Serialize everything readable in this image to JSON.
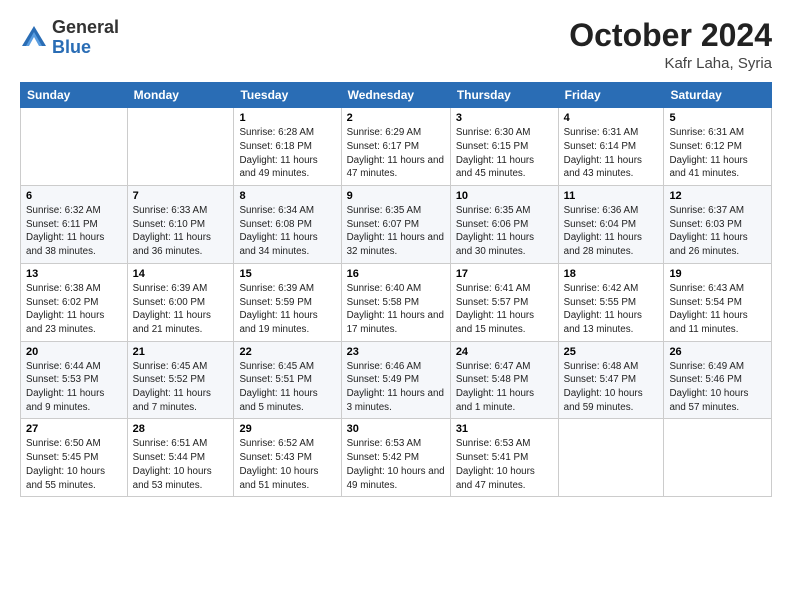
{
  "header": {
    "logo_general": "General",
    "logo_blue": "Blue",
    "month_title": "October 2024",
    "location": "Kafr Laha, Syria"
  },
  "days_of_week": [
    "Sunday",
    "Monday",
    "Tuesday",
    "Wednesday",
    "Thursday",
    "Friday",
    "Saturday"
  ],
  "weeks": [
    [
      {
        "day": "",
        "info": ""
      },
      {
        "day": "",
        "info": ""
      },
      {
        "day": "1",
        "info": "Sunrise: 6:28 AM\nSunset: 6:18 PM\nDaylight: 11 hours and 49 minutes."
      },
      {
        "day": "2",
        "info": "Sunrise: 6:29 AM\nSunset: 6:17 PM\nDaylight: 11 hours and 47 minutes."
      },
      {
        "day": "3",
        "info": "Sunrise: 6:30 AM\nSunset: 6:15 PM\nDaylight: 11 hours and 45 minutes."
      },
      {
        "day": "4",
        "info": "Sunrise: 6:31 AM\nSunset: 6:14 PM\nDaylight: 11 hours and 43 minutes."
      },
      {
        "day": "5",
        "info": "Sunrise: 6:31 AM\nSunset: 6:12 PM\nDaylight: 11 hours and 41 minutes."
      }
    ],
    [
      {
        "day": "6",
        "info": "Sunrise: 6:32 AM\nSunset: 6:11 PM\nDaylight: 11 hours and 38 minutes."
      },
      {
        "day": "7",
        "info": "Sunrise: 6:33 AM\nSunset: 6:10 PM\nDaylight: 11 hours and 36 minutes."
      },
      {
        "day": "8",
        "info": "Sunrise: 6:34 AM\nSunset: 6:08 PM\nDaylight: 11 hours and 34 minutes."
      },
      {
        "day": "9",
        "info": "Sunrise: 6:35 AM\nSunset: 6:07 PM\nDaylight: 11 hours and 32 minutes."
      },
      {
        "day": "10",
        "info": "Sunrise: 6:35 AM\nSunset: 6:06 PM\nDaylight: 11 hours and 30 minutes."
      },
      {
        "day": "11",
        "info": "Sunrise: 6:36 AM\nSunset: 6:04 PM\nDaylight: 11 hours and 28 minutes."
      },
      {
        "day": "12",
        "info": "Sunrise: 6:37 AM\nSunset: 6:03 PM\nDaylight: 11 hours and 26 minutes."
      }
    ],
    [
      {
        "day": "13",
        "info": "Sunrise: 6:38 AM\nSunset: 6:02 PM\nDaylight: 11 hours and 23 minutes."
      },
      {
        "day": "14",
        "info": "Sunrise: 6:39 AM\nSunset: 6:00 PM\nDaylight: 11 hours and 21 minutes."
      },
      {
        "day": "15",
        "info": "Sunrise: 6:39 AM\nSunset: 5:59 PM\nDaylight: 11 hours and 19 minutes."
      },
      {
        "day": "16",
        "info": "Sunrise: 6:40 AM\nSunset: 5:58 PM\nDaylight: 11 hours and 17 minutes."
      },
      {
        "day": "17",
        "info": "Sunrise: 6:41 AM\nSunset: 5:57 PM\nDaylight: 11 hours and 15 minutes."
      },
      {
        "day": "18",
        "info": "Sunrise: 6:42 AM\nSunset: 5:55 PM\nDaylight: 11 hours and 13 minutes."
      },
      {
        "day": "19",
        "info": "Sunrise: 6:43 AM\nSunset: 5:54 PM\nDaylight: 11 hours and 11 minutes."
      }
    ],
    [
      {
        "day": "20",
        "info": "Sunrise: 6:44 AM\nSunset: 5:53 PM\nDaylight: 11 hours and 9 minutes."
      },
      {
        "day": "21",
        "info": "Sunrise: 6:45 AM\nSunset: 5:52 PM\nDaylight: 11 hours and 7 minutes."
      },
      {
        "day": "22",
        "info": "Sunrise: 6:45 AM\nSunset: 5:51 PM\nDaylight: 11 hours and 5 minutes."
      },
      {
        "day": "23",
        "info": "Sunrise: 6:46 AM\nSunset: 5:49 PM\nDaylight: 11 hours and 3 minutes."
      },
      {
        "day": "24",
        "info": "Sunrise: 6:47 AM\nSunset: 5:48 PM\nDaylight: 11 hours and 1 minute."
      },
      {
        "day": "25",
        "info": "Sunrise: 6:48 AM\nSunset: 5:47 PM\nDaylight: 10 hours and 59 minutes."
      },
      {
        "day": "26",
        "info": "Sunrise: 6:49 AM\nSunset: 5:46 PM\nDaylight: 10 hours and 57 minutes."
      }
    ],
    [
      {
        "day": "27",
        "info": "Sunrise: 6:50 AM\nSunset: 5:45 PM\nDaylight: 10 hours and 55 minutes."
      },
      {
        "day": "28",
        "info": "Sunrise: 6:51 AM\nSunset: 5:44 PM\nDaylight: 10 hours and 53 minutes."
      },
      {
        "day": "29",
        "info": "Sunrise: 6:52 AM\nSunset: 5:43 PM\nDaylight: 10 hours and 51 minutes."
      },
      {
        "day": "30",
        "info": "Sunrise: 6:53 AM\nSunset: 5:42 PM\nDaylight: 10 hours and 49 minutes."
      },
      {
        "day": "31",
        "info": "Sunrise: 6:53 AM\nSunset: 5:41 PM\nDaylight: 10 hours and 47 minutes."
      },
      {
        "day": "",
        "info": ""
      },
      {
        "day": "",
        "info": ""
      }
    ]
  ]
}
